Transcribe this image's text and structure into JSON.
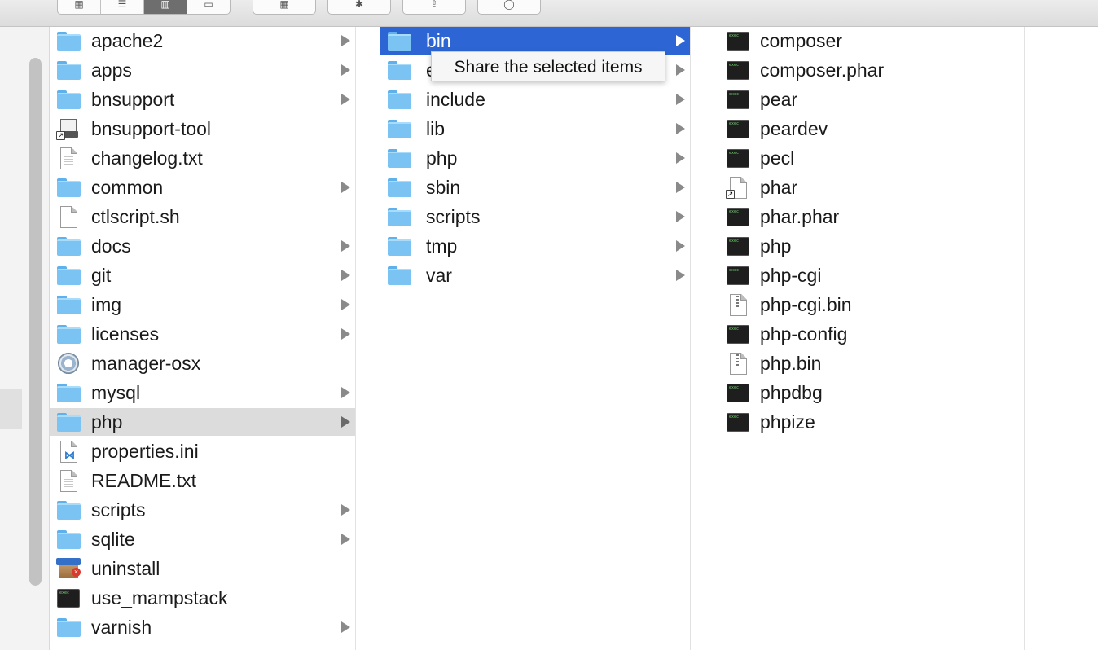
{
  "tooltip": "Share the selected items",
  "column1": [
    {
      "label": "apache2",
      "icon": "folder-icon",
      "arrow": true
    },
    {
      "label": "apps",
      "icon": "folder-icon",
      "arrow": true
    },
    {
      "label": "bnsupport",
      "icon": "folder-icon",
      "arrow": true
    },
    {
      "label": "bnsupport-tool",
      "icon": "alias-app-icon",
      "arrow": false
    },
    {
      "label": "changelog.txt",
      "icon": "text-document-icon",
      "arrow": false
    },
    {
      "label": "common",
      "icon": "folder-icon",
      "arrow": true
    },
    {
      "label": "ctlscript.sh",
      "icon": "document-icon",
      "arrow": false
    },
    {
      "label": "docs",
      "icon": "folder-icon",
      "arrow": true
    },
    {
      "label": "git",
      "icon": "folder-icon",
      "arrow": true
    },
    {
      "label": "img",
      "icon": "folder-icon",
      "arrow": true
    },
    {
      "label": "licenses",
      "icon": "folder-icon",
      "arrow": true
    },
    {
      "label": "manager-osx",
      "icon": "gear-app-icon",
      "arrow": false
    },
    {
      "label": "mysql",
      "icon": "folder-icon",
      "arrow": true
    },
    {
      "label": "php",
      "icon": "folder-icon",
      "arrow": true,
      "selected": "inactive"
    },
    {
      "label": "properties.ini",
      "icon": "vscode-document-icon",
      "arrow": false
    },
    {
      "label": "README.txt",
      "icon": "text-document-icon",
      "arrow": false
    },
    {
      "label": "scripts",
      "icon": "folder-icon",
      "arrow": true
    },
    {
      "label": "sqlite",
      "icon": "folder-icon",
      "arrow": true
    },
    {
      "label": "uninstall",
      "icon": "uninstaller-app-icon",
      "arrow": false
    },
    {
      "label": "use_mampstack",
      "icon": "terminal-executable-icon",
      "arrow": false
    },
    {
      "label": "varnish",
      "icon": "folder-icon",
      "arrow": true
    }
  ],
  "column2": [
    {
      "label": "bin",
      "icon": "folder-icon",
      "arrow": true,
      "selected": "active"
    },
    {
      "label": "e",
      "icon": "folder-icon",
      "arrow": true
    },
    {
      "label": "include",
      "icon": "folder-icon",
      "arrow": true
    },
    {
      "label": "lib",
      "icon": "folder-icon",
      "arrow": true
    },
    {
      "label": "php",
      "icon": "folder-icon",
      "arrow": true
    },
    {
      "label": "sbin",
      "icon": "folder-icon",
      "arrow": true
    },
    {
      "label": "scripts",
      "icon": "folder-icon",
      "arrow": true
    },
    {
      "label": "tmp",
      "icon": "folder-icon",
      "arrow": true
    },
    {
      "label": "var",
      "icon": "folder-icon",
      "arrow": true
    }
  ],
  "column3": [
    {
      "label": "composer",
      "icon": "terminal-executable-icon"
    },
    {
      "label": "composer.phar",
      "icon": "terminal-executable-icon"
    },
    {
      "label": "pear",
      "icon": "terminal-executable-icon"
    },
    {
      "label": "peardev",
      "icon": "terminal-executable-icon"
    },
    {
      "label": "pecl",
      "icon": "terminal-executable-icon"
    },
    {
      "label": "phar",
      "icon": "alias-document-icon"
    },
    {
      "label": "phar.phar",
      "icon": "terminal-executable-icon"
    },
    {
      "label": "php",
      "icon": "terminal-executable-icon"
    },
    {
      "label": "php-cgi",
      "icon": "terminal-executable-icon"
    },
    {
      "label": "php-cgi.bin",
      "icon": "zip-document-icon"
    },
    {
      "label": "php-config",
      "icon": "terminal-executable-icon"
    },
    {
      "label": "php.bin",
      "icon": "zip-document-icon"
    },
    {
      "label": "phpdbg",
      "icon": "terminal-executable-icon"
    },
    {
      "label": "phpize",
      "icon": "terminal-executable-icon"
    }
  ],
  "colors": {
    "selection_active": "#2d66d4",
    "selection_inactive": "#dcdcdc",
    "folder": "#7ac3f3"
  }
}
